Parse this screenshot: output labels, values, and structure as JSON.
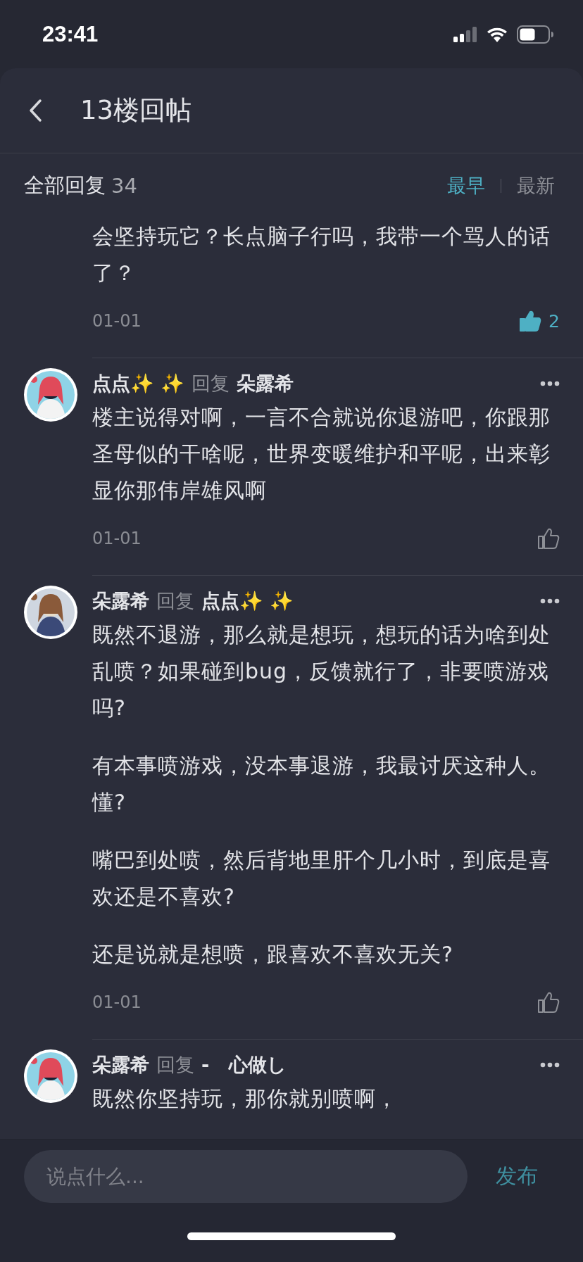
{
  "status_bar": {
    "time": "23:41"
  },
  "header": {
    "title": "13楼回帖"
  },
  "replies_bar": {
    "label": "全部回复",
    "count": "34",
    "sort_tabs": [
      {
        "label": "最早",
        "selected": true
      },
      {
        "label": "最新",
        "selected": false
      }
    ]
  },
  "comments": [
    {
      "kind": "partial",
      "body": [
        "会坚持玩它？长点脑子行吗，我带一个骂人的话了？"
      ],
      "date": "01-01",
      "liked": true,
      "likes": "2"
    },
    {
      "kind": "full",
      "user": "点点✨ ✨",
      "reply_label": "回复",
      "reply_to": "朵露希",
      "body": [
        "楼主说得对啊，一言不合就说你退游吧，你跟那圣母似的干啥呢，世界变暖维护和平呢，出来彰显你那伟岸雄风啊"
      ],
      "date": "01-01",
      "liked": false
    },
    {
      "kind": "full",
      "user": "朵露希",
      "reply_label": "回复",
      "reply_to": "点点✨ ✨",
      "body": [
        "既然不退游，那么就是想玩，想玩的话为啥到处乱喷？如果碰到bug，反馈就行了，非要喷游戏吗?",
        "有本事喷游戏，没本事退游，我最讨厌这种人。懂?",
        "嘴巴到处喷，然后背地里肝个几小时，到底是喜欢还是不喜欢?",
        "还是说就是想喷，跟喜欢不喜欢无关?"
      ],
      "date": "01-01",
      "liked": false
    },
    {
      "kind": "full",
      "user": "朵露希",
      "reply_label": "回复",
      "reply_to": "-   心做し",
      "body": [
        "既然你坚持玩，那你就别喷啊，"
      ]
    }
  ],
  "composer": {
    "placeholder": "说点什么...",
    "send": "发布"
  }
}
